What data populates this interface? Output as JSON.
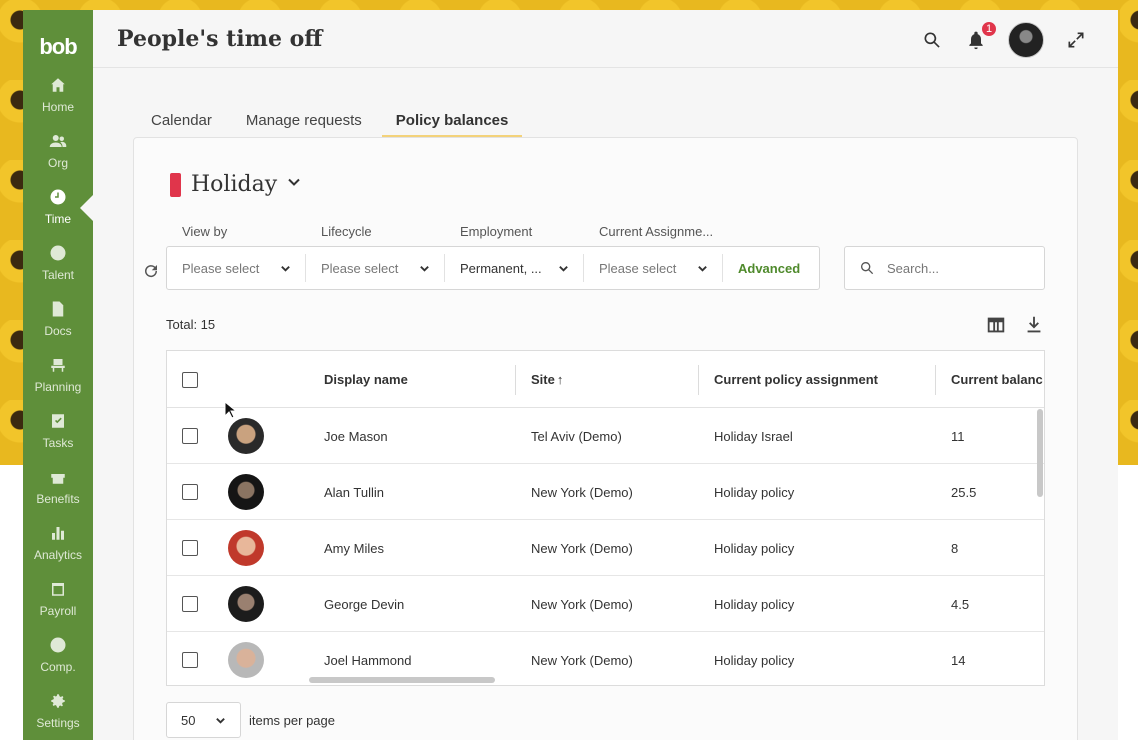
{
  "app": {
    "logo": "bob",
    "page_title": "People's time off",
    "notification_count": "1"
  },
  "sidebar": {
    "items": [
      {
        "label": "Home",
        "icon": "home-icon",
        "active": false
      },
      {
        "label": "Org",
        "icon": "people-icon",
        "active": false
      },
      {
        "label": "Time",
        "icon": "clock-icon",
        "active": true
      },
      {
        "label": "Talent",
        "icon": "talent-icon",
        "active": false
      },
      {
        "label": "Docs",
        "icon": "document-icon",
        "active": false
      },
      {
        "label": "Planning",
        "icon": "planning-icon",
        "active": false
      },
      {
        "label": "Tasks",
        "icon": "tasks-icon",
        "active": false
      },
      {
        "label": "Benefits",
        "icon": "gift-icon",
        "active": false
      },
      {
        "label": "Analytics",
        "icon": "bar-chart-icon",
        "active": false
      },
      {
        "label": "Payroll",
        "icon": "payroll-icon",
        "active": false
      },
      {
        "label": "Comp.",
        "icon": "dollar-icon",
        "active": false
      },
      {
        "label": "Settings",
        "icon": "gear-icon",
        "active": false
      }
    ]
  },
  "tabs": [
    {
      "label": "Calendar",
      "active": false
    },
    {
      "label": "Manage requests",
      "active": false
    },
    {
      "label": "Policy balances",
      "active": true
    }
  ],
  "policy": {
    "name": "Holiday",
    "color": "#e0354b"
  },
  "filters": {
    "labels": [
      "View by",
      "Lifecycle",
      "Employment",
      "Current Assignme..."
    ],
    "values": [
      "Please select",
      "Please select",
      "Permanent, ...",
      "Please select"
    ],
    "advanced_label": "Advanced"
  },
  "search": {
    "placeholder": "Search..."
  },
  "total_label": "Total: 15",
  "table": {
    "columns": [
      "Display name",
      "Site",
      "Current policy assignment",
      "Current balanc"
    ],
    "sort_indicator": "↑",
    "rows": [
      {
        "name": "Joe Mason",
        "site": "Tel Aviv (Demo)",
        "policy": "Holiday Israel",
        "balance": "11"
      },
      {
        "name": "Alan Tullin",
        "site": "New York (Demo)",
        "policy": "Holiday policy",
        "balance": "25.5"
      },
      {
        "name": "Amy Miles",
        "site": "New York (Demo)",
        "policy": "Holiday policy",
        "balance": "8"
      },
      {
        "name": "George Devin",
        "site": "New York (Demo)",
        "policy": "Holiday policy",
        "balance": "4.5"
      },
      {
        "name": "Joel Hammond",
        "site": "New York (Demo)",
        "policy": "Holiday policy",
        "balance": "14"
      }
    ]
  },
  "pagination": {
    "per_page_value": "50",
    "per_page_label": "items per page"
  },
  "colors": {
    "sidebar": "#5f8f3a",
    "accent_green": "#4f8a2c",
    "tab_underline": "#f3d27a",
    "badge": "#e0354b"
  }
}
